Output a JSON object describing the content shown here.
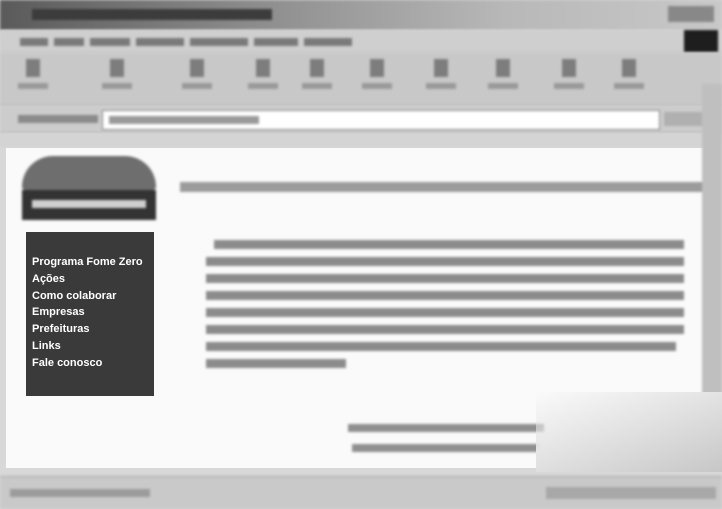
{
  "sidebar": {
    "items": [
      {
        "label": "Programa Fome Zero"
      },
      {
        "label": "Ações"
      },
      {
        "label": "Como colaborar"
      },
      {
        "label": "Empresas"
      },
      {
        "label": "Prefeituras"
      },
      {
        "label": "Links"
      },
      {
        "label": "Fale conosco"
      }
    ]
  }
}
